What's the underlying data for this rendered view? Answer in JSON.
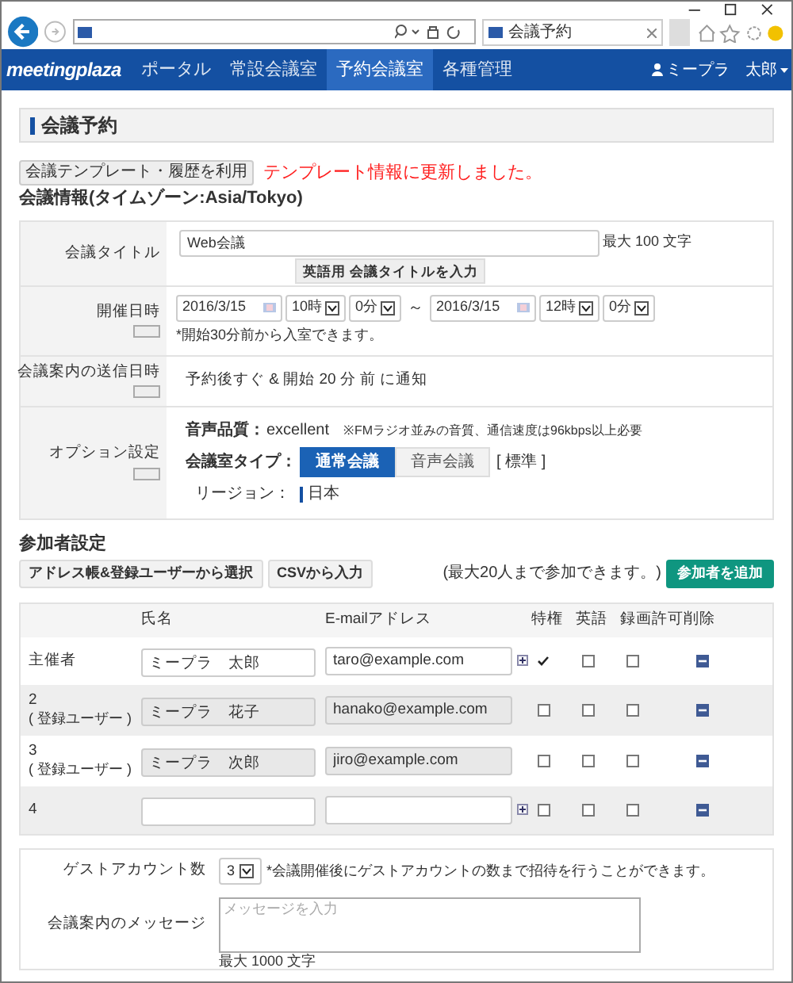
{
  "browser": {
    "tab_title": "会議予約"
  },
  "nav": {
    "logo": "meetingplaza",
    "items": [
      {
        "label": "ポータル",
        "selected": false
      },
      {
        "label": "常設会議室",
        "selected": false
      },
      {
        "label": "予約会議室",
        "selected": true
      },
      {
        "label": "各種管理",
        "selected": false
      }
    ],
    "user": "ミープラ　太郎"
  },
  "page_title": "会議予約",
  "template_button": "会議テンプレート・履歴を利用",
  "notice": "テンプレート情報に更新しました。",
  "section_heading": "会議情報(タイムゾーン:Asia/Tokyo)",
  "meeting_title": {
    "label": "会議タイトル",
    "value": "Web会議",
    "note": "最大 100 文字",
    "english_button": "英語用 会議タイトルを入力"
  },
  "schedule": {
    "label": "開催日時",
    "start_date": "2016/3/15",
    "start_hour": "10時",
    "start_minute": "0分",
    "separator": "～",
    "end_date": "2016/3/15",
    "end_hour": "12時",
    "end_minute": "0分",
    "note": "*開始30分前から入室できます。"
  },
  "notification": {
    "label": "会議案内の送信日時",
    "text": "予約後すぐ & 開始 20 分 前 に通知"
  },
  "options": {
    "label": "オプション設定",
    "audio_quality_label": "音声品質：",
    "audio_quality": "excellent",
    "audio_note": "※FMラジオ並みの音質、通信速度は96kbps以上必要",
    "room_type_label": "会議室タイプ：",
    "room_types": [
      {
        "label": "通常会議",
        "selected": true
      },
      {
        "label": "音声会議",
        "selected": false
      }
    ],
    "room_type_value": "[ 標準 ]",
    "region_label": "リージョン：",
    "region": "日本"
  },
  "participants": {
    "heading": "参加者設定",
    "buttons": [
      "アドレス帳&登録ユーザーから選択",
      "CSVから入力"
    ],
    "limit_note": "(最大20人まで参加できます。)",
    "add_button": "参加者を追加",
    "columns": [
      "氏名",
      "E-mailアドレス",
      "特権",
      "英語",
      "録画許可",
      "削除"
    ],
    "rows": [
      {
        "label": "主催者",
        "name": "ミープラ　太郎",
        "email": "taro@example.com",
        "editable": true,
        "privileged": true,
        "english": false,
        "recording": false
      },
      {
        "label": "2",
        "sublabel": "( 登録ユーザー )",
        "name": "ミープラ　花子",
        "email": "hanako@example.com",
        "editable": false,
        "privileged": false,
        "english": false,
        "recording": false
      },
      {
        "label": "3",
        "sublabel": "( 登録ユーザー )",
        "name": "ミープラ　次郎",
        "email": "jiro@example.com",
        "editable": false,
        "privileged": false,
        "english": false,
        "recording": false
      },
      {
        "label": "4",
        "editable": true,
        "privileged": false,
        "english": false,
        "recording": false
      }
    ]
  },
  "guest": {
    "label": "ゲストアカウント数",
    "value": "3",
    "note": "*会議開催後にゲストアカウントの数まで招待を行うことができます。"
  },
  "message": {
    "label": "会議案内のメッセージ",
    "placeholder": "メッセージを入力",
    "note": "最大 1000 文字"
  }
}
